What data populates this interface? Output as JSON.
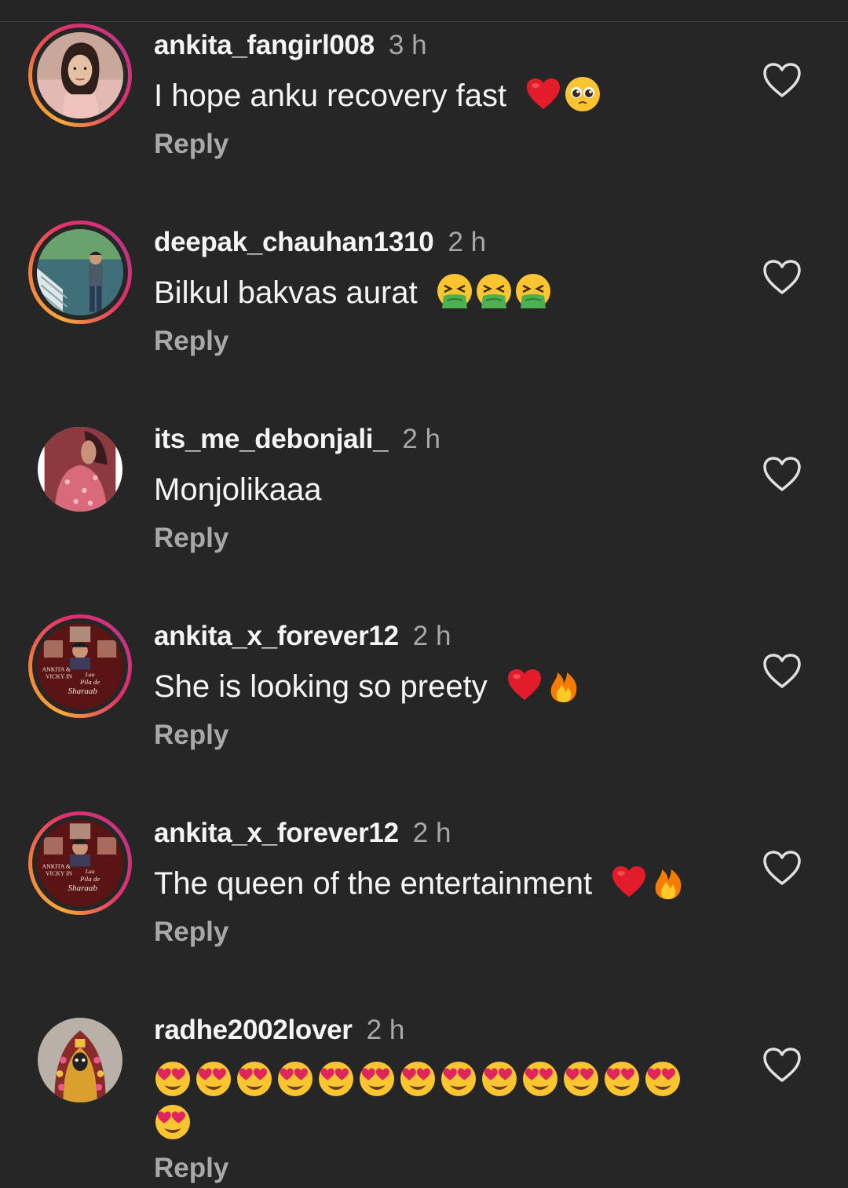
{
  "comments": [
    {
      "username": "ankita_fangirl008",
      "time": "3 h",
      "text": "I hope anku recovery fast",
      "emojis": [
        "red-heart",
        "pleading-face"
      ],
      "reply_label": "Reply",
      "avatar_ring": true
    },
    {
      "username": "deepak_chauhan1310",
      "time": "2 h",
      "text": "Bilkul bakvas aurat",
      "emojis": [
        "vomiting-face",
        "vomiting-face",
        "vomiting-face"
      ],
      "reply_label": "Reply",
      "avatar_ring": true
    },
    {
      "username": "its_me_debonjali_",
      "time": "2 h",
      "text": "Monjolikaaa",
      "emojis": [],
      "reply_label": "Reply",
      "avatar_ring": false
    },
    {
      "username": "ankita_x_forever12",
      "time": "2 h",
      "text": "She is looking so preety",
      "emojis": [
        "red-heart",
        "fire"
      ],
      "reply_label": "Reply",
      "avatar_ring": true
    },
    {
      "username": "ankita_x_forever12",
      "time": "2 h",
      "text": "The queen of the entertainment",
      "emojis": [
        "red-heart",
        "fire"
      ],
      "reply_label": "Reply",
      "avatar_ring": true
    },
    {
      "username": "radhe2002lover",
      "time": "2 h",
      "text": "",
      "emojis": [
        "heart-eyes",
        "heart-eyes",
        "heart-eyes",
        "heart-eyes",
        "heart-eyes",
        "heart-eyes",
        "heart-eyes",
        "heart-eyes",
        "heart-eyes",
        "heart-eyes",
        "heart-eyes",
        "heart-eyes",
        "heart-eyes",
        "heart-eyes"
      ],
      "reply_label": "Reply",
      "avatar_ring": false
    }
  ],
  "avatar_text": {
    "poster_line1": "ANKITA &",
    "poster_line2": "VICKY IN",
    "poster_line3": "Laa",
    "poster_line4": "Pila de",
    "poster_line5": "Sharaab"
  },
  "colors": {
    "background": "#262626",
    "primary_text": "#f5f5f5",
    "secondary_text": "#a8a8a8",
    "ring_start": "#f9a83a",
    "ring_end": "#c13584"
  },
  "icons": {
    "like": "heart-outline-icon"
  }
}
